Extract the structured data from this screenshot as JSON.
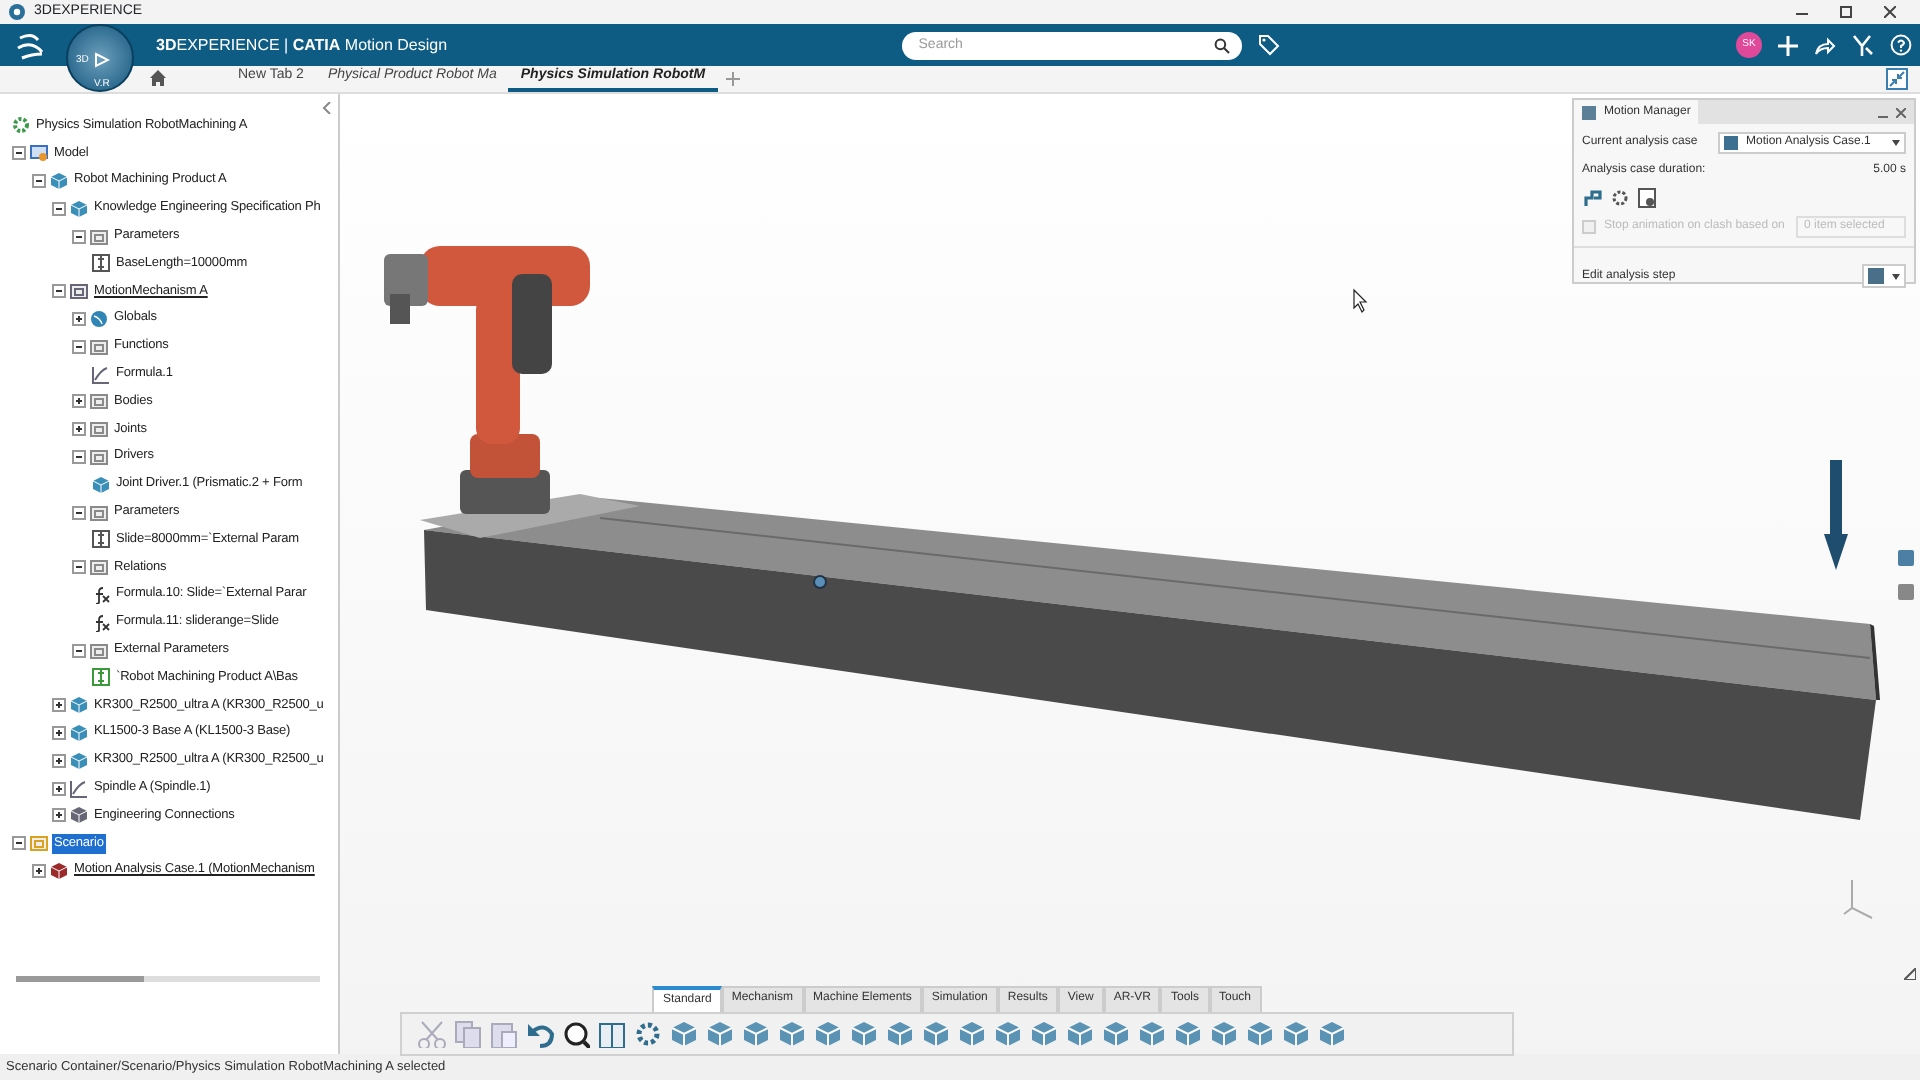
{
  "window": {
    "title": "3DEXPERIENCE"
  },
  "topbar": {
    "compass_labels": [
      "3D",
      "V.R"
    ],
    "brand": "**3D**EXPERIENCE | **CATIA** Motion Design",
    "search": {
      "placeholder": "Search"
    },
    "avatar": "SK"
  },
  "tabs": [
    {
      "label": "New Tab 2",
      "selected": false
    },
    {
      "label": "Physical Product Robot Ma",
      "selected": false
    },
    {
      "label": "Physics Simulation RobotM",
      "selected": true
    }
  ],
  "tree": {
    "items": [
      {
        "label": "Physics Simulation RobotMachining A",
        "kind": "simulation",
        "selected": false,
        "children": [
          {
            "label": "Model",
            "kind": "model",
            "expanded": true,
            "selected": false,
            "children": [
              {
                "label": "Robot Machining Product A",
                "kind": "product",
                "expanded": true,
                "selected": false,
                "children": [
                  {
                    "label": "Knowledge Engineering Specification Ph",
                    "kind": "product",
                    "expanded": true,
                    "selected": false,
                    "children": [
                      {
                        "label": "Parameters",
                        "kind": "folder",
                        "expanded": true,
                        "selected": false,
                        "children": [
                          {
                            "label": "BaseLength=10000mm",
                            "kind": "parameter",
                            "selected": false
                          }
                        ]
                      }
                    ]
                  },
                  {
                    "label": "MotionMechanism A",
                    "kind": "mechanism",
                    "expanded": true,
                    "selected": false,
                    "underlined": true,
                    "children": [
                      {
                        "label": "Globals",
                        "kind": "globe",
                        "expanded": false,
                        "selected": false
                      },
                      {
                        "label": "Functions",
                        "kind": "folder",
                        "expanded": true,
                        "selected": false,
                        "children": [
                          {
                            "label": "Formula.1",
                            "kind": "chart",
                            "selected": false
                          }
                        ]
                      },
                      {
                        "label": "Bodies",
                        "kind": "folder",
                        "expanded": false,
                        "selected": false
                      },
                      {
                        "label": "Joints",
                        "kind": "folder",
                        "expanded": false,
                        "selected": false
                      },
                      {
                        "label": "Drivers",
                        "kind": "folder",
                        "expanded": true,
                        "selected": false,
                        "children": [
                          {
                            "label": "Joint Driver.1 (Prismatic.2 + Form",
                            "kind": "product",
                            "selected": false
                          }
                        ]
                      },
                      {
                        "label": "Parameters",
                        "kind": "folder",
                        "expanded": true,
                        "selected": false,
                        "children": [
                          {
                            "label": "Slide=8000mm=`External Param",
                            "kind": "parameter",
                            "selected": false
                          }
                        ]
                      },
                      {
                        "label": "Relations",
                        "kind": "folder",
                        "expanded": true,
                        "selected": false,
                        "children": [
                          {
                            "label": "Formula.10: Slide=`External Parar",
                            "kind": "formula",
                            "selected": false
                          },
                          {
                            "label": "Formula.11: sliderange=Slide",
                            "kind": "formula",
                            "selected": false
                          }
                        ]
                      },
                      {
                        "label": "External Parameters",
                        "kind": "folder",
                        "expanded": true,
                        "selected": false,
                        "children": [
                          {
                            "label": "`Robot Machining Product A\\Bas",
                            "kind": "external",
                            "selected": false
                          }
                        ]
                      }
                    ]
                  },
                  {
                    "label": "KR300_R2500_ultra A (KR300_R2500_u",
                    "kind": "product",
                    "expanded": false,
                    "selected": false
                  },
                  {
                    "label": "KL1500-3  Base A (KL1500-3  Base)",
                    "kind": "product",
                    "expanded": false,
                    "selected": false
                  },
                  {
                    "label": "KR300_R2500_ultra A (KR300_R2500_u",
                    "kind": "product",
                    "expanded": false,
                    "selected": false
                  },
                  {
                    "label": "Spindle A (Spindle.1)",
                    "kind": "chart",
                    "expanded": false,
                    "selected": false
                  },
                  {
                    "label": "Engineering Connections",
                    "kind": "connections",
                    "expanded": false,
                    "selected": false
                  }
                ]
              }
            ]
          },
          {
            "label": "Scenario",
            "kind": "scenario",
            "expanded": true,
            "selected": true,
            "children": [
              {
                "label": "Motion Analysis Case.1 (MotionMechanism",
                "kind": "case",
                "expanded": false,
                "selected": false,
                "underlined": true
              }
            ]
          }
        ]
      }
    ]
  },
  "motion_manager": {
    "title": "Motion Manager",
    "case_label": "Current analysis case",
    "case_value": "Motion Analysis Case.1",
    "duration_label": "Analysis case duration:",
    "duration_value": "5.00 s",
    "stop_animation": {
      "label": "Stop animation on clash based on",
      "checked": false,
      "disabled": true,
      "value": "0 item selected"
    },
    "edit_step_label": "Edit analysis step"
  },
  "toolbar": {
    "tabs": [
      {
        "label": "Standard",
        "selected": true
      },
      {
        "label": "Mechanism",
        "selected": false
      },
      {
        "label": "Machine Elements",
        "selected": false
      },
      {
        "label": "Simulation",
        "selected": false
      },
      {
        "label": "Results",
        "selected": false
      },
      {
        "label": "View",
        "selected": false
      },
      {
        "label": "AR-VR",
        "selected": false
      },
      {
        "label": "Tools",
        "selected": false
      },
      {
        "label": "Touch",
        "selected": false
      }
    ]
  },
  "status_bar": "Scenario Container/Scenario/Physics Simulation RobotMachining A selected"
}
